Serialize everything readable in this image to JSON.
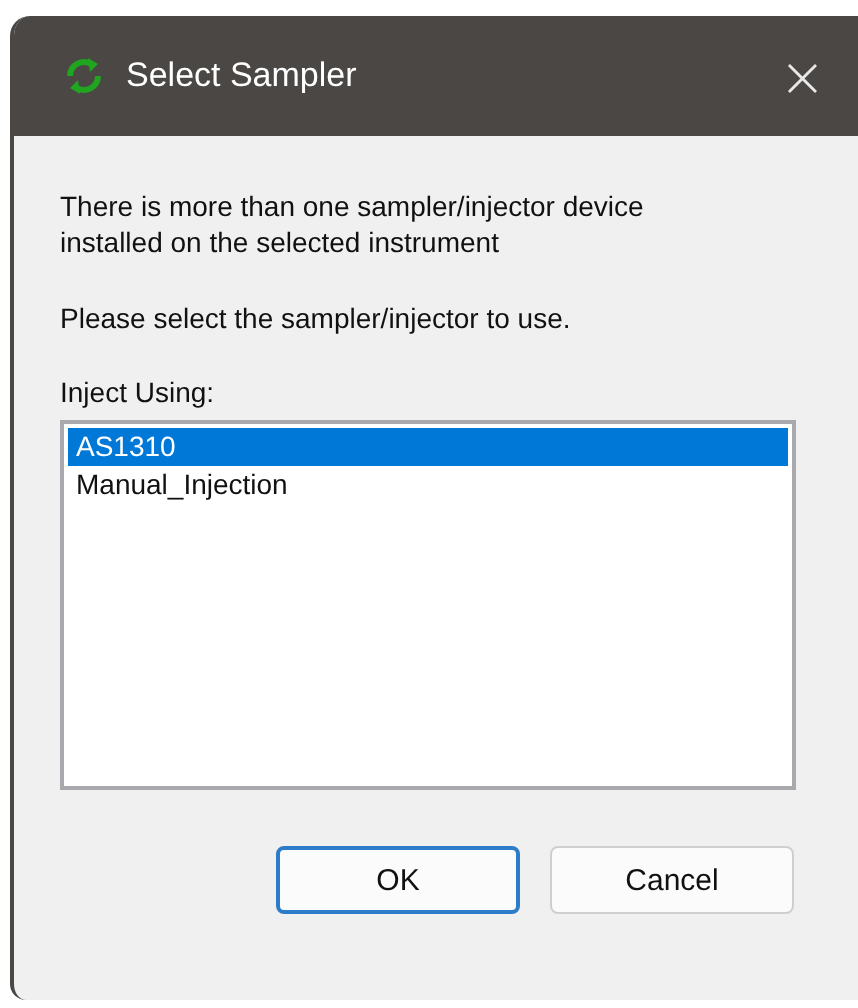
{
  "window": {
    "title": "Select Sampler",
    "close": "×"
  },
  "message": [
    "There is more than one sampler/injector device installed on the selected instrument",
    "Please select the sampler/injector to use."
  ],
  "list": {
    "label": "Inject Using:",
    "items": [
      {
        "label": "AS1310",
        "selected": true
      },
      {
        "label": "Manual_Injection",
        "selected": false
      }
    ]
  },
  "buttons": [
    {
      "label": "OK",
      "default": true
    },
    {
      "label": "Cancel",
      "default": false
    }
  ]
}
